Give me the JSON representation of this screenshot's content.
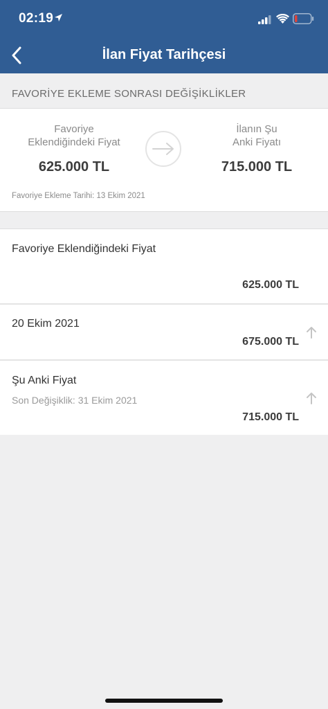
{
  "status_bar": {
    "time": "02:19"
  },
  "nav": {
    "title": "İlan Fiyat Tarihçesi"
  },
  "section": {
    "title": "FAVORİYE EKLEME SONRASI DEĞİŞİKLİKLER"
  },
  "compare": {
    "left_label_line1": "Favoriye",
    "left_label_line2": "Eklendiğindeki Fiyat",
    "left_price": "625.000 TL",
    "right_label_line1": "İlanın Şu",
    "right_label_line2": "Anki Fiyatı",
    "right_price": "715.000 TL",
    "favorite_date": "Favoriye Ekleme Tarihi: 13 Ekim 2021"
  },
  "history": [
    {
      "title": "Favoriye Eklendiğindeki Fiyat",
      "price": "625.000 TL"
    },
    {
      "title": "20 Ekim 2021",
      "price": "675.000 TL"
    },
    {
      "title": "Şu Anki Fiyat",
      "subtitle": "Son Değişiklik: 31 Ekim 2021",
      "price": "715.000 TL"
    }
  ],
  "icons": {
    "back": "chevron-left-icon",
    "compare_arrow": "arrow-right-icon",
    "price_up": "arrow-up-icon",
    "location": "location-arrow-icon",
    "signal": "signal-icon",
    "wifi": "wifi-icon",
    "battery": "battery-icon"
  },
  "colors": {
    "header": "#305d94",
    "background": "#efeff0",
    "battery_low": "#e0443a"
  }
}
